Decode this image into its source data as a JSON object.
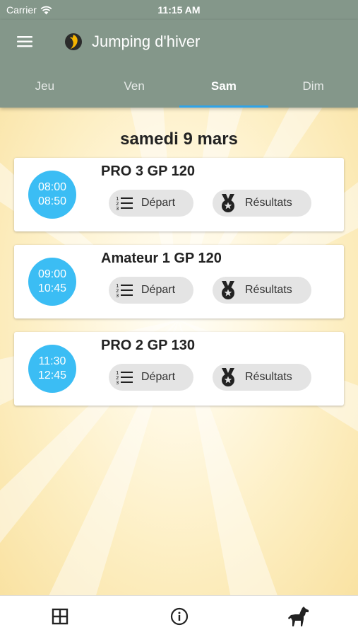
{
  "status_bar": {
    "carrier": "Carrier",
    "time": "11:15 AM"
  },
  "app_bar": {
    "title": "Jumping d'hiver",
    "menu_icon": "hamburger-menu-icon",
    "logo_icon": "app-logo-icon"
  },
  "tabs": [
    {
      "label": "Jeu",
      "active": false
    },
    {
      "label": "Ven",
      "active": false
    },
    {
      "label": "Sam",
      "active": true
    },
    {
      "label": "Dim",
      "active": false
    }
  ],
  "colors": {
    "app_bar": "#84978a",
    "accent": "#2fa3e8",
    "time_circle": "#3bbdf4",
    "pill": "#e4e4e4"
  },
  "date_heading": "samedi 9 mars",
  "events": [
    {
      "start": "08:00",
      "end": "08:50",
      "title": "PRO 3 GP 120",
      "depart_label": "Départ",
      "results_label": "Résultats"
    },
    {
      "start": "09:00",
      "end": "10:45",
      "title": "Amateur 1 GP 120",
      "depart_label": "Départ",
      "results_label": "Résultats"
    },
    {
      "start": "11:30",
      "end": "12:45",
      "title": "PRO 2 GP 130",
      "depart_label": "Départ",
      "results_label": "Résultats"
    }
  ],
  "bottom_nav": [
    {
      "icon": "grid-icon"
    },
    {
      "icon": "info-icon"
    },
    {
      "icon": "horse-icon"
    }
  ]
}
